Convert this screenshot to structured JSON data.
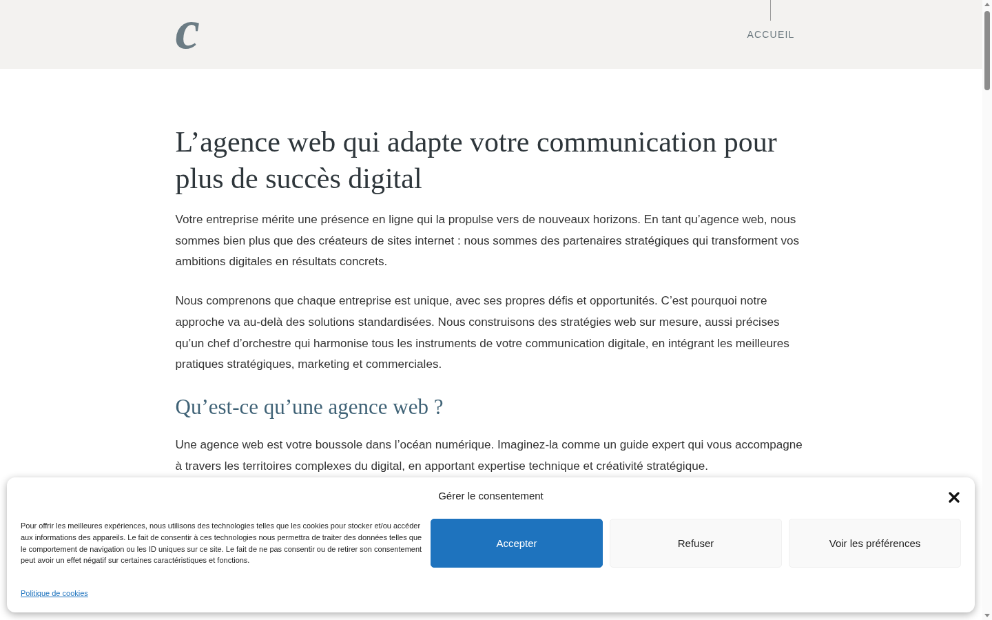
{
  "header": {
    "logo": "c",
    "nav": [
      {
        "label": "ACCUEIL",
        "selected": true
      }
    ]
  },
  "article": {
    "title": "L’agence web qui adapte votre communication pour plus de succès digital",
    "blocks": [
      {
        "kind": "paragraph",
        "text": "Votre entreprise mérite une présence en ligne qui la propulse vers de nouveaux horizons. En tant qu’agence web, nous sommes bien plus que des créateurs de sites internet : nous sommes des partenaires stratégiques qui transforment vos ambitions digitales en résultats concrets."
      },
      {
        "kind": "paragraph",
        "text": "Nous comprenons que chaque entreprise est unique, avec ses propres défis et opportunités. C’est pourquoi notre approche va au-delà des solutions standardisées. Nous construisons des stratégies web sur mesure, aussi précises qu’un chef d’orchestre qui harmonise tous les instruments de votre communication digitale, en intégrant les meilleures pratiques stratégiques, marketing et commerciales."
      },
      {
        "kind": "heading",
        "text": "Qu’est-ce qu’une agence web ?"
      },
      {
        "kind": "paragraph",
        "text": "Une agence web est votre boussole dans l’océan numérique. Imaginez-la comme un guide expert qui vous accompagne à travers les territoires complexes du digital, en apportant expertise technique et créativité stratégique."
      }
    ]
  },
  "consent_banner": {
    "title": "Gérer le consentement",
    "message": "Pour offrir les meilleures expériences, nous utilisons des technologies telles que les cookies pour stocker et/ou accéder aux informations des appareils. Le fait de consentir à ces technologies nous permettra de traiter des données telles que le comportement de navigation ou les ID uniques sur ce site. Le fait de ne pas consentir ou de retirer son consentement peut avoir un effet négatif sur certaines caractéristiques et fonctions.",
    "policy_link": "Politique de cookies",
    "buttons": [
      {
        "kind": "accept",
        "label": "Accepter"
      },
      {
        "kind": "refuse",
        "label": "Refuser"
      },
      {
        "kind": "preferences",
        "label": "Voir les préférences"
      }
    ]
  }
}
